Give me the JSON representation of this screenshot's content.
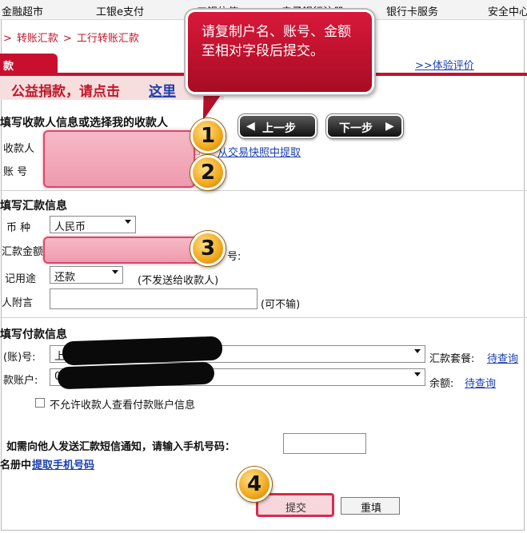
{
  "topnav": {
    "items": [
      "金融超市",
      "工银e支付",
      "工银信使",
      "电子银行注册",
      "银行卡服务",
      "安全中心"
    ]
  },
  "breadcrumb": {
    "items": [
      "转账汇款",
      "工行转账汇款"
    ]
  },
  "tab": {
    "label": "款"
  },
  "eval_link": ">>体验评价",
  "banner": {
    "text": "公益捐款，请点击",
    "link": "这里"
  },
  "callout": {
    "text": "请复制户名、账号、金额至相对字段后提交。"
  },
  "nav_buttons": {
    "prev": "上一步",
    "next": "下一步"
  },
  "payee_section": {
    "title": "填写收款人信息或选择我的收款人",
    "name_label": "收款人",
    "account_label": "账  号",
    "history_link": "从交易快照中提取",
    "name_value": "",
    "account_value": ""
  },
  "remit_section": {
    "title": "填写汇款信息",
    "currency_label": "币  种",
    "currency_value": "人民币",
    "amount_label": "汇款金额",
    "amount_value": "",
    "amount_suffix": "号:",
    "purpose_label": "记用途",
    "purpose_value": "还款",
    "purpose_note": "(不发送给收款人)",
    "memo_label": "人附言",
    "memo_value": "",
    "memo_note": "(可不输)"
  },
  "payer_section": {
    "title": "填写付款信息",
    "card_label": "(账)号:",
    "card_value": "上",
    "account_label": "款账户:",
    "account_value": "00",
    "package_label": "汇款套餐:",
    "package_link": "待查询",
    "balance_label": "余额:",
    "balance_link": "待查询",
    "hide_info_label": "不允许收款人查看付款账户信息"
  },
  "sms_section": {
    "prompt": "如需向他人发送汇款短信通知，请输入手机号码：",
    "phone_value": "",
    "addressbook_prefix": "名册中",
    "addressbook_link": "提取手机号码"
  },
  "buttons": {
    "submit": "提交",
    "reset": "重填"
  },
  "badges": [
    "1",
    "2",
    "3",
    "4"
  ],
  "colors": {
    "brand_red": "#c8102e",
    "link_blue": "#1a3fb0",
    "badge_gold": "#f0a81c"
  }
}
